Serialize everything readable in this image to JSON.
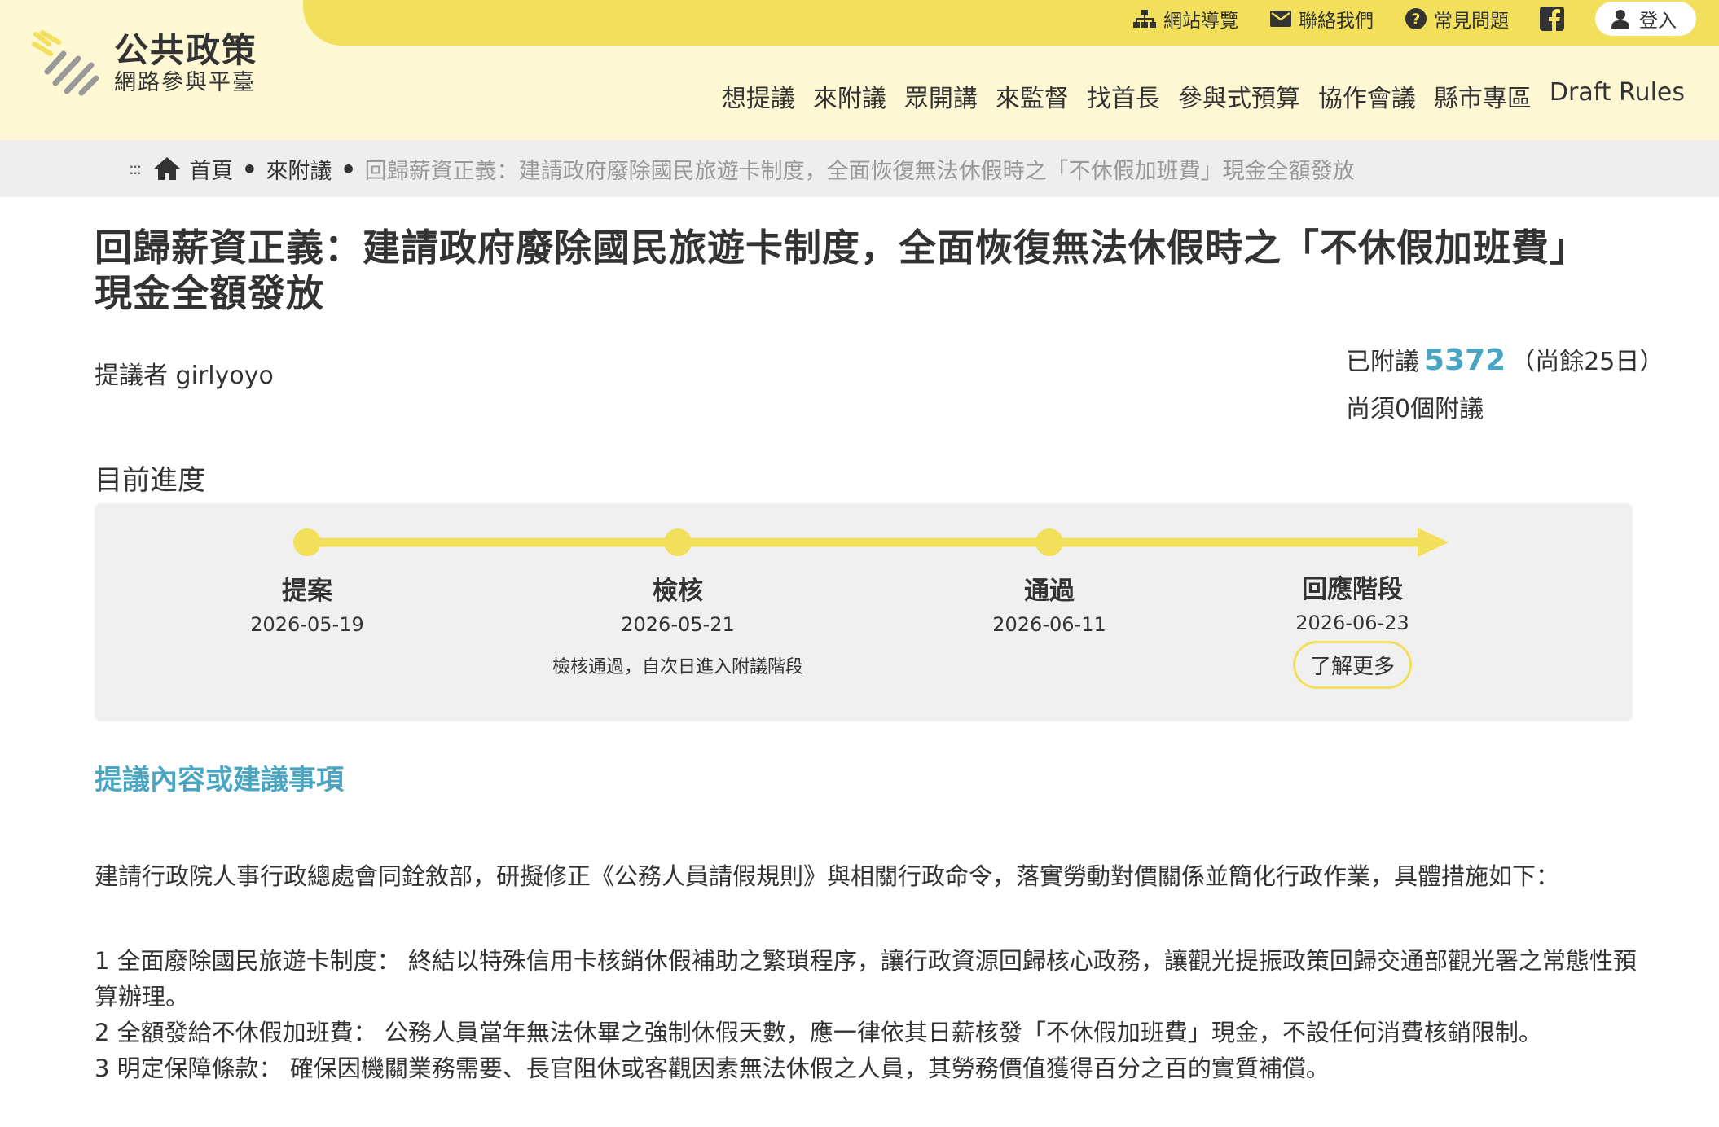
{
  "header": {
    "logo_main": "公共政策",
    "logo_sub": "網路參與平臺",
    "top_links": {
      "sitemap": "網站導覽",
      "contact": "聯絡我們",
      "faq": "常見問題",
      "login": "登入"
    },
    "nav": [
      "想提議",
      "來附議",
      "眾開講",
      "來監督",
      "找首長",
      "參與式預算",
      "協作會議",
      "縣市專區",
      "Draft Rules"
    ]
  },
  "breadcrumb": {
    "dots": ":::",
    "home": "首頁",
    "section": "來附議",
    "current": "回歸薪資正義：建請政府廢除國民旅遊卡制度，全面恢復無法休假時之「不休假加班費」現金全額發放"
  },
  "proposal": {
    "title": "回歸薪資正義：建請政府廢除國民旅遊卡制度，全面恢復無法休假時之「不休假加班費」現金全額發放",
    "proposer": "提議者 girlyoyo",
    "signed_label": "已附議",
    "signed_count": "5372",
    "days_left": "（尚餘25日）",
    "remaining": "尚須0個附議"
  },
  "progress": {
    "heading": "目前進度",
    "steps": [
      {
        "name": "提案",
        "date": "2026-05-19",
        "note": ""
      },
      {
        "name": "檢核",
        "date": "2026-05-21",
        "note": "檢核通過，自次日進入附議階段"
      },
      {
        "name": "通過",
        "date": "2026-06-11",
        "note": ""
      },
      {
        "name": "回應階段",
        "date": "2026-06-23",
        "note": ""
      }
    ],
    "more_button": "了解更多"
  },
  "content": {
    "section_title": "提議內容或建議事項",
    "intro": "建請行政院人事行政總處會同銓敘部，研擬修正《公務人員請假規則》與相關行政命令，落實勞動對價關係並簡化行政作業，具體措施如下：",
    "items": [
      "1 全面廢除國民旅遊卡制度： 終結以特殊信用卡核銷休假補助之繁瑣程序，讓行政資源回歸核心政務，讓觀光提振政策回歸交通部觀光署之常態性預算辦理。",
      "2 全額發給不休假加班費： 公務人員當年無法休畢之強制休假天數，應一律依其日薪核發「不休假加班費」現金，不設任何消費核銷限制。",
      "3 明定保障條款： 確保因機關業務需要、長官阻休或客觀因素無法休假之人員，其勞務價值獲得百分之百的實質補償。"
    ]
  },
  "colors": {
    "accent_yellow": "#f2e05c",
    "header_bg": "#fdf8d3",
    "link_blue": "#4aa5c3"
  }
}
